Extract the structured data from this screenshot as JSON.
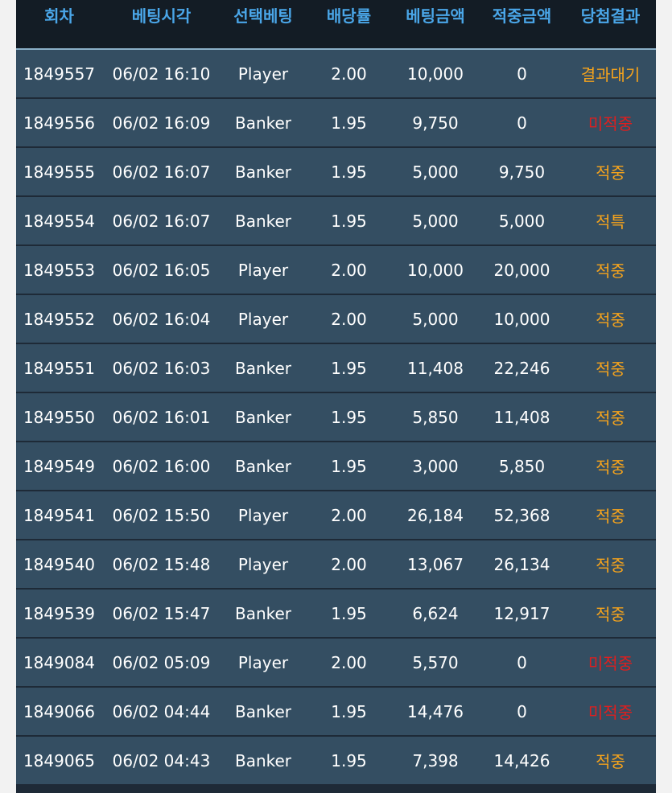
{
  "header": {
    "round": "회차",
    "bet_time": "베팅시각",
    "selection": "선택베팅",
    "odds": "배당률",
    "bet_amount": "베팅금액",
    "win_amount": "적중금액",
    "result": "당첨결과"
  },
  "colors": {
    "header_text": "#4aa6e8",
    "row_bg": "#344e62",
    "row_border": "#8ab0c8",
    "result_win_pending": "#f5a31c",
    "result_lose": "#e01e1e"
  },
  "rows": [
    {
      "round": "1849557",
      "time": "06/02 16:10",
      "pick": "Player",
      "odds": "2.00",
      "bet": "10,000",
      "win": "0",
      "result": "결과대기",
      "status": "pending"
    },
    {
      "round": "1849556",
      "time": "06/02 16:09",
      "pick": "Banker",
      "odds": "1.95",
      "bet": "9,750",
      "win": "0",
      "result": "미적중",
      "status": "lose"
    },
    {
      "round": "1849555",
      "time": "06/02 16:07",
      "pick": "Banker",
      "odds": "1.95",
      "bet": "5,000",
      "win": "9,750",
      "result": "적중",
      "status": "win"
    },
    {
      "round": "1849554",
      "time": "06/02 16:07",
      "pick": "Banker",
      "odds": "1.95",
      "bet": "5,000",
      "win": "5,000",
      "result": "적특",
      "status": "win"
    },
    {
      "round": "1849553",
      "time": "06/02 16:05",
      "pick": "Player",
      "odds": "2.00",
      "bet": "10,000",
      "win": "20,000",
      "result": "적중",
      "status": "win"
    },
    {
      "round": "1849552",
      "time": "06/02 16:04",
      "pick": "Player",
      "odds": "2.00",
      "bet": "5,000",
      "win": "10,000",
      "result": "적중",
      "status": "win"
    },
    {
      "round": "1849551",
      "time": "06/02 16:03",
      "pick": "Banker",
      "odds": "1.95",
      "bet": "11,408",
      "win": "22,246",
      "result": "적중",
      "status": "win"
    },
    {
      "round": "1849550",
      "time": "06/02 16:01",
      "pick": "Banker",
      "odds": "1.95",
      "bet": "5,850",
      "win": "11,408",
      "result": "적중",
      "status": "win"
    },
    {
      "round": "1849549",
      "time": "06/02 16:00",
      "pick": "Banker",
      "odds": "1.95",
      "bet": "3,000",
      "win": "5,850",
      "result": "적중",
      "status": "win"
    },
    {
      "round": "1849541",
      "time": "06/02 15:50",
      "pick": "Player",
      "odds": "2.00",
      "bet": "26,184",
      "win": "52,368",
      "result": "적중",
      "status": "win"
    },
    {
      "round": "1849540",
      "time": "06/02 15:48",
      "pick": "Player",
      "odds": "2.00",
      "bet": "13,067",
      "win": "26,134",
      "result": "적중",
      "status": "win"
    },
    {
      "round": "1849539",
      "time": "06/02 15:47",
      "pick": "Banker",
      "odds": "1.95",
      "bet": "6,624",
      "win": "12,917",
      "result": "적중",
      "status": "win"
    },
    {
      "round": "1849084",
      "time": "06/02 05:09",
      "pick": "Player",
      "odds": "2.00",
      "bet": "5,570",
      "win": "0",
      "result": "미적중",
      "status": "lose"
    },
    {
      "round": "1849066",
      "time": "06/02 04:44",
      "pick": "Banker",
      "odds": "1.95",
      "bet": "14,476",
      "win": "0",
      "result": "미적중",
      "status": "lose"
    },
    {
      "round": "1849065",
      "time": "06/02 04:43",
      "pick": "Banker",
      "odds": "1.95",
      "bet": "7,398",
      "win": "14,426",
      "result": "적중",
      "status": "win"
    }
  ]
}
